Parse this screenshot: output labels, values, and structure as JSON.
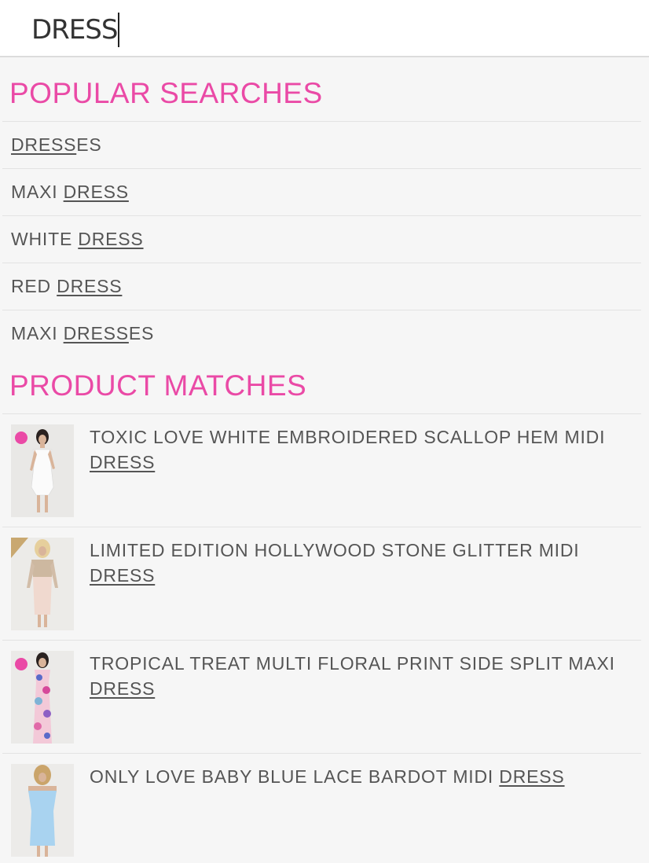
{
  "search": {
    "value": "DRESS"
  },
  "popular": {
    "title": "POPULAR SEARCHES",
    "items": [
      {
        "pre": "",
        "match": "DRESS",
        "post": "ES"
      },
      {
        "pre": "MAXI ",
        "match": "DRESS",
        "post": ""
      },
      {
        "pre": "WHITE ",
        "match": "DRESS",
        "post": ""
      },
      {
        "pre": "RED ",
        "match": "DRESS",
        "post": ""
      },
      {
        "pre": "MAXI ",
        "match": "DRESS",
        "post": "ES"
      }
    ]
  },
  "products": {
    "title": "PRODUCT MATCHES",
    "items": [
      {
        "pre": "TOXIC LOVE WHITE EMBROIDERED SCALLOP HEM MIDI ",
        "match": "DRESS",
        "post": ""
      },
      {
        "pre": "LIMITED EDITION HOLLYWOOD STONE GLITTER MIDI ",
        "match": "DRESS",
        "post": ""
      },
      {
        "pre": "TROPICAL TREAT MULTI FLORAL PRINT SIDE SPLIT MAXI ",
        "match": "DRESS",
        "post": ""
      },
      {
        "pre": "ONLY LOVE BABY BLUE LACE BARDOT MIDI ",
        "match": "DRESS",
        "post": ""
      }
    ]
  },
  "colors": {
    "accent": "#ea4aa6",
    "text": "#555555",
    "background": "#f6f6f6"
  }
}
